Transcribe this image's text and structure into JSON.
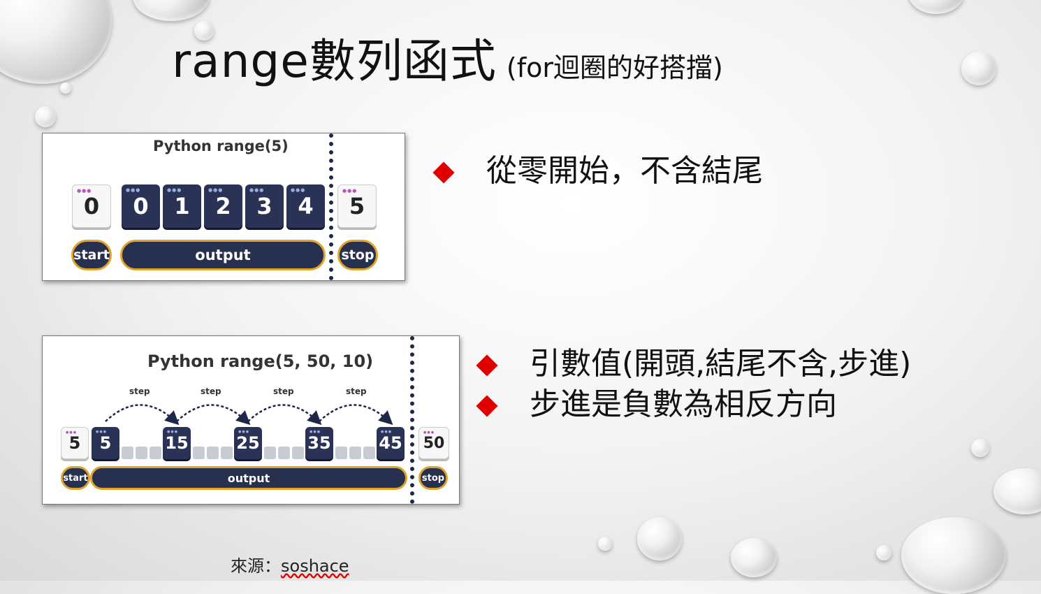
{
  "title": {
    "main": "range數列函式",
    "sub": "(for迴圈的好搭擋)"
  },
  "panel1": {
    "title": "Python range(5)",
    "start_value": "0",
    "outputs": [
      "0",
      "1",
      "2",
      "3",
      "4"
    ],
    "stop_value": "5",
    "start_label": "start",
    "output_label": "output",
    "stop_label": "stop"
  },
  "panel2": {
    "title": "Python range(5, 50, 10)",
    "start_value": "5",
    "outputs": [
      "5",
      "15",
      "25",
      "35",
      "45"
    ],
    "stop_value": "50",
    "step_label": "step",
    "start_label": "start",
    "output_label": "output",
    "stop_label": "stop"
  },
  "bullets1": [
    "從零開始，不含結尾"
  ],
  "bullets2": [
    "引數值(開頭,結尾不含,步進)",
    "步進是負數為相反方向"
  ],
  "source": {
    "prefix": "來源：",
    "name": "soshace"
  },
  "colors": {
    "navy": "#2a3355",
    "gold": "#e0a42b",
    "bullet": "#e00000"
  }
}
